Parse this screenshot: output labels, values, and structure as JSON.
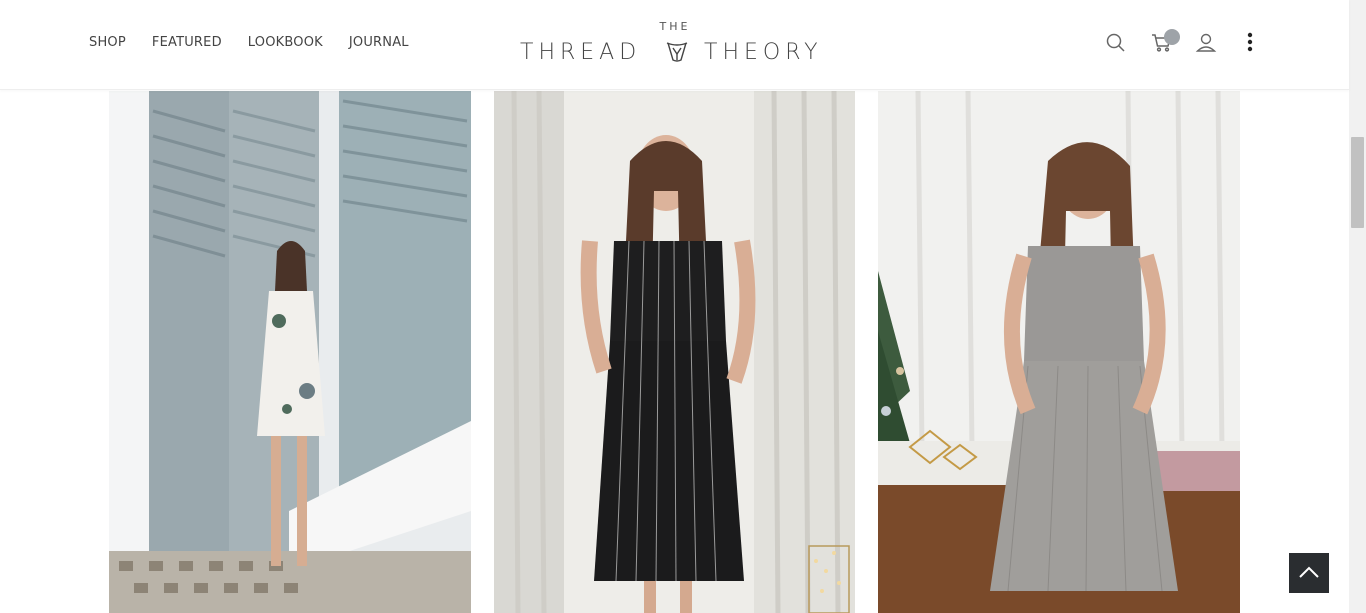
{
  "nav": {
    "items": [
      "SHOP",
      "FEATURED",
      "LOOKBOOK",
      "JOURNAL"
    ]
  },
  "logo": {
    "small": "THE",
    "left_word": "THREAD",
    "right_word": "THEORY"
  },
  "header_icons": [
    "search-icon",
    "cart-icon",
    "user-icon",
    "more-vertical-icon"
  ],
  "products": [
    {
      "name": "white-floral-shift-dress-photo"
    },
    {
      "name": "black-pinstripe-lace-up-midi-dress-photo"
    },
    {
      "name": "grey-linen-pinafore-dress-photo"
    }
  ],
  "back_to_top_icon": "chevron-up-icon",
  "colors": {
    "header_bg": "#ffffff",
    "text": "#444444",
    "badge": "#9ea3a8",
    "back_to_top_bg": "#2a2d30"
  }
}
